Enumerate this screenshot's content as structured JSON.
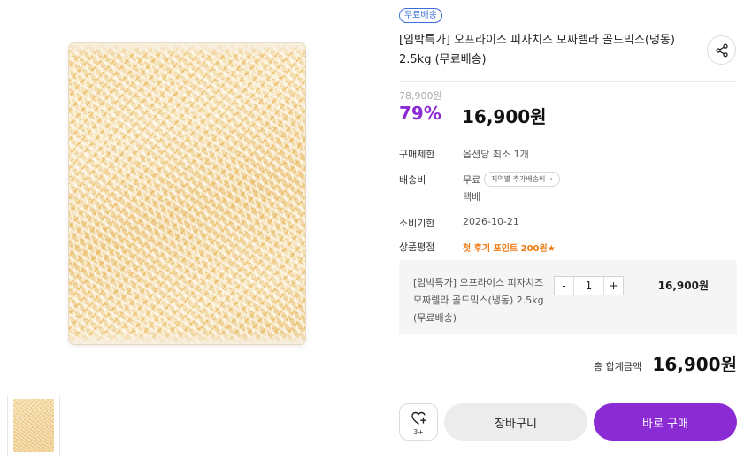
{
  "product": {
    "badge": "무료배송",
    "title": "[임박특가] 오프라이스 피자치즈 모짜렐라 골드믹스(냉동) 2.5kg (무료배송)",
    "original_price": "78,900원",
    "discount_rate": "79%",
    "sale_price": "16,900원"
  },
  "details": {
    "purchase_limit_label": "구매제한",
    "purchase_limit_value": "옵션당 최소 1개",
    "shipping_label": "배송비",
    "shipping_value": "무료",
    "shipping_region_pill": "지역별 추가배송비",
    "shipping_method": "택배",
    "expiry_label": "소비기한",
    "expiry_value": "2026-10-21",
    "rating_label": "상품평점",
    "rating_value": "첫 후기 포인트 200원★"
  },
  "option": {
    "name": "[임박특가] 오프라이스 피자치즈 모짜렐라 골드믹스(냉동) 2.5kg (무료배송)",
    "minus": "-",
    "quantity": "1",
    "plus": "+",
    "price": "16,900원"
  },
  "total": {
    "label": "총 합계금액",
    "price": "16,900원"
  },
  "actions": {
    "wish_count": "3+",
    "cart_label": "장바구니",
    "buy_label": "바로 구매"
  },
  "colors": {
    "accent": "#8b2bd4",
    "badge_blue": "#3a6fd8",
    "review_orange": "#f07a12"
  },
  "icons": {
    "share": "share-icon",
    "wish": "heart-plus-icon",
    "region_chevron": "chevron-right-icon"
  }
}
